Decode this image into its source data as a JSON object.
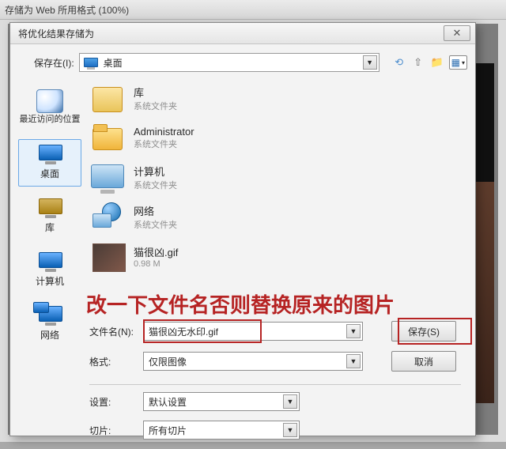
{
  "app": {
    "title": "存储为 Web 所用格式 (100%)"
  },
  "dialog": {
    "title": "将优化结果存储为",
    "lookin_label": "保存在(I):",
    "lookin_value": "桌面",
    "toolbar": {
      "back": "back-icon",
      "up": "up-icon",
      "newfolder": "new-folder-icon",
      "viewmenu": "view-menu-icon"
    }
  },
  "places": [
    {
      "label": "最近访问的位置",
      "key": "recent"
    },
    {
      "label": "桌面",
      "key": "desktop",
      "selected": true
    },
    {
      "label": "库",
      "key": "libraries"
    },
    {
      "label": "计算机",
      "key": "computer"
    },
    {
      "label": "网络",
      "key": "network"
    }
  ],
  "entries": [
    {
      "title": "库",
      "sub": "系统文件夹",
      "icon": "library"
    },
    {
      "title": "Administrator",
      "sub": "系统文件夹",
      "icon": "folder"
    },
    {
      "title": "计算机",
      "sub": "系统文件夹",
      "icon": "computer"
    },
    {
      "title": "网络",
      "sub": "系统文件夹",
      "icon": "network"
    },
    {
      "title": "猫很凶.gif",
      "sub": "0.98 M",
      "icon": "thumb"
    }
  ],
  "form": {
    "filename_label": "文件名(N):",
    "filename_value": "猫很凶无水印.gif",
    "format_label": "格式:",
    "format_value": "仅限图像",
    "settings_label": "设置:",
    "settings_value": "默认设置",
    "slices_label": "切片:",
    "slices_value": "所有切片",
    "save_label": "保存(S)",
    "cancel_label": "取消"
  },
  "annotation": {
    "text": "改一下文件名否则替换原来的图片"
  }
}
